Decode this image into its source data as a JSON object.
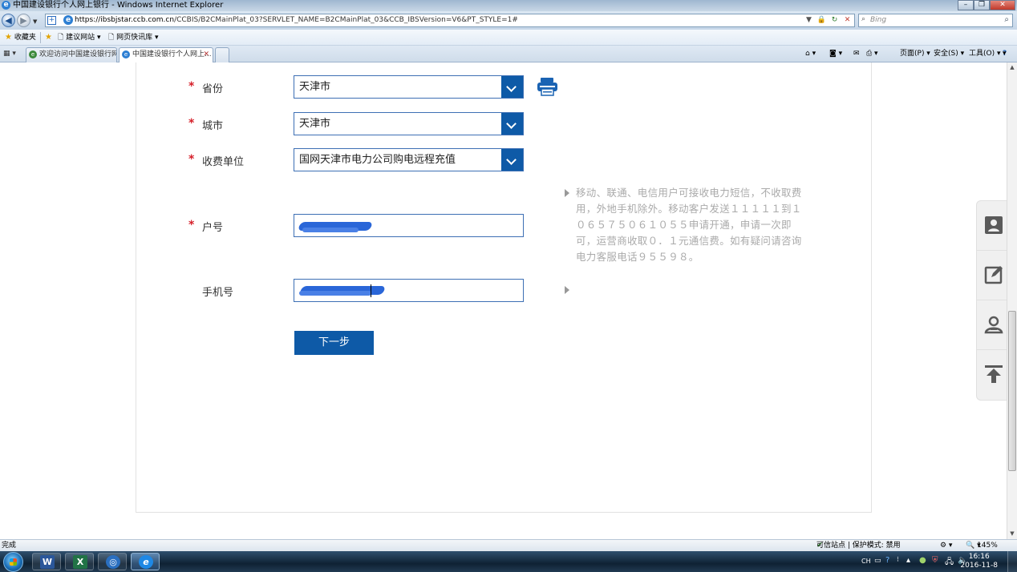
{
  "window": {
    "title": "中国建设银行个人网上银行 - Windows Internet Explorer"
  },
  "address_bar": {
    "url_host": "https://ibsbjstar.ccb.com.cn",
    "url_rest": "/CCBIS/B2CMainPlat_03?SERVLET_NAME=B2CMainPlat_03&CCB_IBSVersion=V6&PT_STYLE=1#",
    "search_placeholder": "Bing"
  },
  "favorites_bar": {
    "favorites_label": "收藏夹",
    "items": [
      "建议网站 ▾",
      "网页快讯库 ▾"
    ]
  },
  "tabs": [
    {
      "label": "欢迎访问中国建设银行网站",
      "active": false
    },
    {
      "label": "中国建设银行个人网上...",
      "active": true
    }
  ],
  "command_bar": {
    "page_menu": "页面(P) ▾",
    "safety_menu": "安全(S) ▾",
    "tools_menu": "工具(O) ▾",
    "help_menu": "▾"
  },
  "form": {
    "required_mark": "*",
    "province": {
      "label": "省份",
      "value": "天津市"
    },
    "city": {
      "label": "城市",
      "value": "天津市"
    },
    "payee": {
      "label": "收费单位",
      "value": "国网天津市电力公司购电远程充值"
    },
    "account": {
      "label": "户号"
    },
    "phone": {
      "label": "手机号"
    },
    "help_text": "移动、联通、电信用户可接收电力短信，不收取费用，外地手机除外。移动客户发送１１１１１到１０６５７５０６１０５５申请开通，申请一次即可，运营商收取０．１元通信费。如有疑问请咨询电力客服电话９５５９８。",
    "next_button": "下一步"
  },
  "floating_toolbar": {
    "items": [
      "contact-card-icon",
      "edit-icon",
      "customer-service-icon",
      "back-to-top-icon"
    ]
  },
  "status_bar": {
    "status": "完成",
    "zone": "可信站点 | 保护模式: 禁用",
    "zoom": "145%"
  },
  "taskbar": {
    "apps": [
      {
        "name": "word",
        "glyph": "W",
        "color": "#2b579a"
      },
      {
        "name": "excel",
        "glyph": "X",
        "color": "#217346"
      },
      {
        "name": "outlook",
        "glyph": "◎",
        "color": "#2a6fc0"
      },
      {
        "name": "internet-explorer",
        "glyph": "e",
        "color": "#1e88e5"
      }
    ],
    "lang": "CH",
    "time": "16:16",
    "date": "2016-11-8"
  }
}
